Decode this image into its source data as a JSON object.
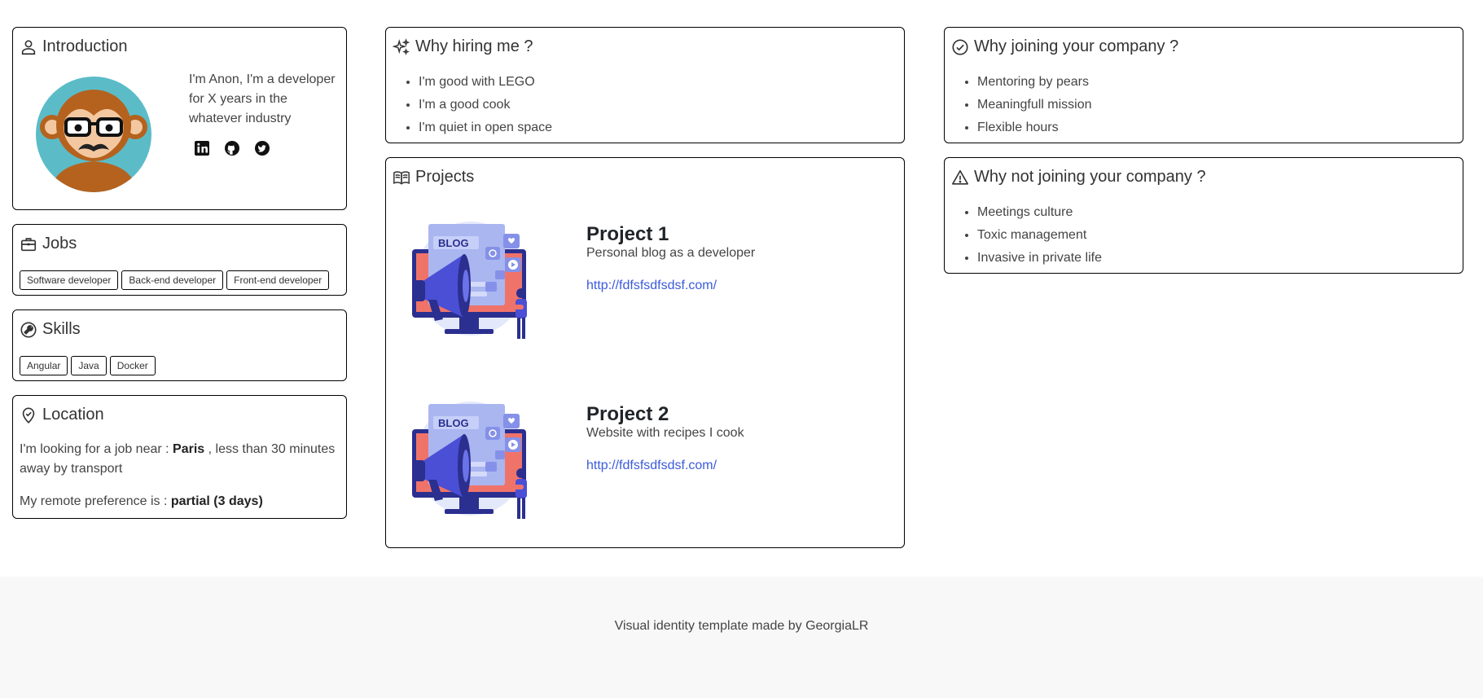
{
  "introduction": {
    "title": "Introduction",
    "text": "I'm Anon, I'm a developer for X years in the whatever industry",
    "socials": [
      "linkedin-icon",
      "github-icon",
      "twitter-icon"
    ]
  },
  "jobs": {
    "title": "Jobs",
    "tags": [
      "Software developer",
      "Back-end developer",
      "Front-end developer"
    ]
  },
  "skills": {
    "title": "Skills",
    "tags": [
      "Angular",
      "Java",
      "Docker"
    ]
  },
  "location": {
    "title": "Location",
    "line1_prefix": "I'm looking for a job near : ",
    "city": "Paris",
    "line1_suffix": " , less than 30 minutes away by transport",
    "line2_prefix": "My remote preference is : ",
    "remote": "partial (3 days)"
  },
  "why_hiring": {
    "title": "Why hiring me ?",
    "items": [
      "I'm good with LEGO",
      "I'm a good cook",
      "I'm quiet in open space"
    ]
  },
  "projects": {
    "title": "Projects",
    "items": [
      {
        "name": "Project 1",
        "description": "Personal blog as a developer",
        "link": "http://fdfsfsdfsdsf.com/",
        "image_text": "BLOG"
      },
      {
        "name": "Project 2",
        "description": "Website with recipes I cook",
        "link": "http://fdfsfsdfsdsf.com/",
        "image_text": "BLOG"
      }
    ]
  },
  "why_joining": {
    "title": "Why joining your company ?",
    "items": [
      "Mentoring by pears",
      "Meaningfull mission",
      "Flexible hours"
    ]
  },
  "why_not_joining": {
    "title": "Why not joining your company ?",
    "items": [
      "Meetings culture",
      "Toxic management",
      "Invasive in private life"
    ]
  },
  "footer": {
    "text": "Visual identity template made by GeorgiaLR"
  },
  "colors": {
    "link": "#3b5bdb",
    "avatar_bg": "#5bbcc8",
    "footer_bg": "#f8f8f8"
  }
}
